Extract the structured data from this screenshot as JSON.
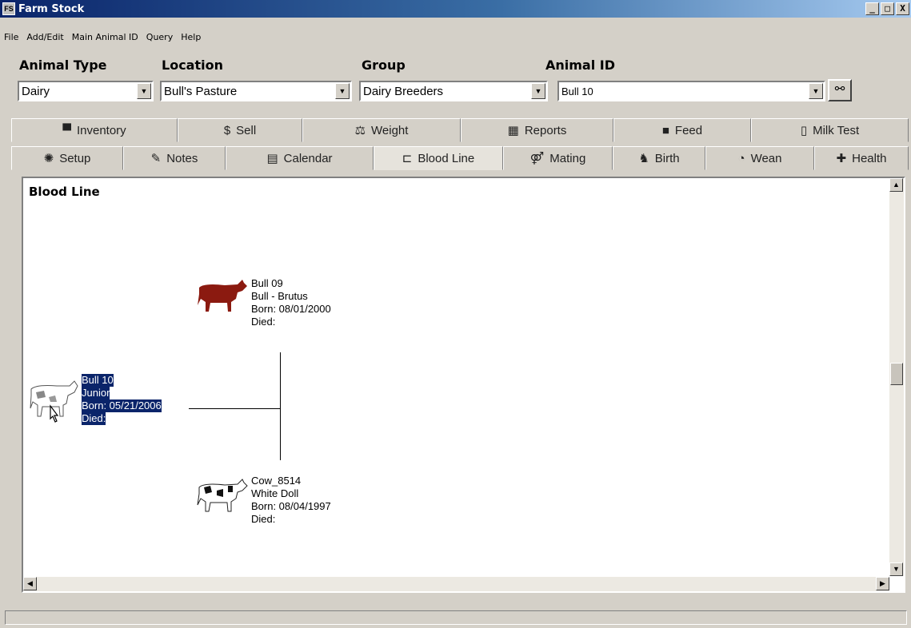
{
  "window": {
    "title": "Farm Stock",
    "icon_label": "FS",
    "controls": {
      "minimize": "_",
      "maximize": "□",
      "close": "X"
    }
  },
  "menu": [
    "File",
    "Add/Edit",
    "Main Animal ID",
    "Query",
    "Help"
  ],
  "selectors": {
    "animal_type": {
      "label": "Animal Type",
      "value": "Dairy"
    },
    "location": {
      "label": "Location",
      "value": "Bull's Pasture"
    },
    "group": {
      "label": "Group",
      "value": "Dairy Breeders"
    },
    "animal_id": {
      "label": "Animal ID",
      "value": "Bull 10"
    }
  },
  "find_button_icon": "binoculars-icon",
  "tabs_top": [
    {
      "label": "Inventory",
      "icon": "inventory-icon",
      "glyph": "▀"
    },
    {
      "label": "Sell",
      "icon": "dollar-icon",
      "glyph": "$"
    },
    {
      "label": "Weight",
      "icon": "scale-icon",
      "glyph": "⚖"
    },
    {
      "label": "Reports",
      "icon": "reports-icon",
      "glyph": "▦"
    },
    {
      "label": "Feed",
      "icon": "feed-icon",
      "glyph": "■"
    },
    {
      "label": "Milk Test",
      "icon": "milk-icon",
      "glyph": "▯"
    }
  ],
  "tabs_bottom": [
    {
      "label": "Setup",
      "icon": "setup-icon",
      "glyph": "✺"
    },
    {
      "label": "Notes",
      "icon": "notes-icon",
      "glyph": "✎"
    },
    {
      "label": "Calendar",
      "icon": "calendar-icon",
      "glyph": "▤"
    },
    {
      "label": "Blood Line",
      "icon": "bloodline-icon",
      "glyph": "⊏",
      "active": true
    },
    {
      "label": "Mating",
      "icon": "mating-icon",
      "glyph": "⚤"
    },
    {
      "label": "Birth",
      "icon": "birth-icon",
      "glyph": "♞"
    },
    {
      "label": "Wean",
      "icon": "wean-icon",
      "glyph": "◔"
    },
    {
      "label": "Health",
      "icon": "health-icon",
      "glyph": "✚"
    }
  ],
  "panel": {
    "title": "Blood Line",
    "sire": {
      "id": "Bull 09",
      "name": "Bull - Brutus",
      "born": "Born: 08/01/2000",
      "died": "Died:"
    },
    "animal": {
      "id": "Bull 10",
      "name": "Junior",
      "born": "Born: 05/21/2006",
      "died": "Died:"
    },
    "dam": {
      "id": "Cow_8514",
      "name": "White Doll",
      "born": "Born: 08/04/1997",
      "died": "Died:"
    }
  },
  "colors": {
    "selection": "#0a246a",
    "sire_cow": "#8b1a10",
    "title_bar": "#0a246a"
  }
}
